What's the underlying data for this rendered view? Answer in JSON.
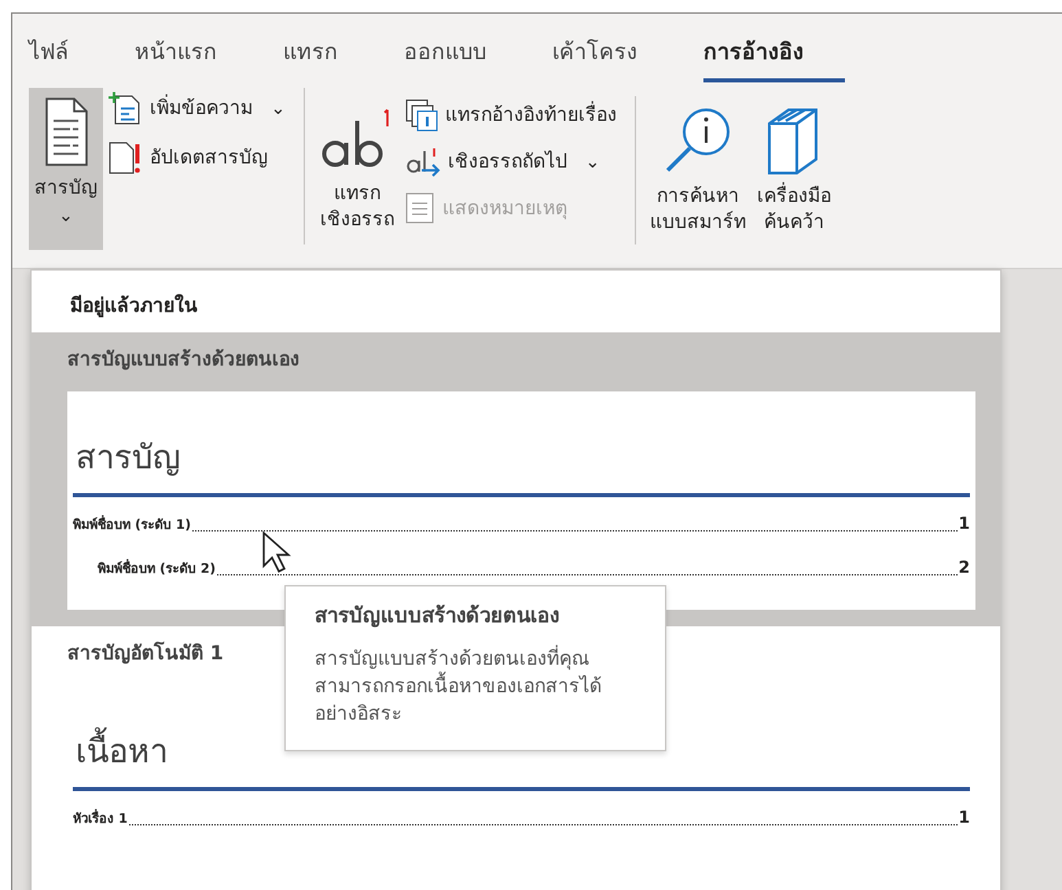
{
  "tabs": [
    {
      "label": "ไฟล์",
      "selected": false
    },
    {
      "label": "หน้าแรก",
      "selected": false
    },
    {
      "label": "แทรก",
      "selected": false
    },
    {
      "label": "ออกแบบ",
      "selected": false
    },
    {
      "label": "เค้าโครง",
      "selected": false
    },
    {
      "label": "การอ้างอิง",
      "selected": true
    }
  ],
  "ribbon_groups": [
    {
      "items": [
        {
          "kind": "large",
          "label": "สารบัญ",
          "caret": true,
          "pressed": true,
          "disabled": false
        },
        {
          "kind": "small",
          "label": "เพิ่มข้อความ",
          "caret": true,
          "pressed": false,
          "disabled": false
        },
        {
          "kind": "small",
          "label": "อัปเดตสารบัญ",
          "caret": false,
          "pressed": false,
          "disabled": false
        }
      ]
    },
    {
      "items": [
        {
          "kind": "large",
          "label": "แทรก\nเชิงอรรถ",
          "caret": false,
          "pressed": false,
          "disabled": false
        },
        {
          "kind": "small",
          "label": "แทรกอ้างอิงท้ายเรื่อง",
          "caret": false,
          "pressed": false,
          "disabled": false
        },
        {
          "kind": "small",
          "label": "เชิงอรรถถัดไป",
          "caret": true,
          "pressed": false,
          "disabled": false
        },
        {
          "kind": "small",
          "label": "แสดงหมายเหตุ",
          "caret": false,
          "pressed": false,
          "disabled": true
        }
      ]
    },
    {
      "items": [
        {
          "kind": "large",
          "label": "การค้นหา\nแบบสมาร์ท",
          "caret": false,
          "pressed": false,
          "disabled": false
        },
        {
          "kind": "large",
          "label": "เครื่องมือ\nค้นคว้า",
          "caret": false,
          "pressed": false,
          "disabled": false
        }
      ]
    }
  ],
  "caret_glyph": "⌄",
  "dropdown": {
    "heading": "มีอยู่แล้วภายใน",
    "gallery": [
      {
        "title": "สารบัญแบบสร้างด้วยตนเอง",
        "selected": true,
        "preview": {
          "heading": "สารบัญ",
          "entries": [
            {
              "text": "พิมพ์ชื่อบท (ระดับ 1)",
              "page": "1",
              "children": [
                {
                  "text": "พิมพ์ชื่อบท (ระดับ 2)",
                  "page": "2"
                }
              ]
            }
          ]
        }
      },
      {
        "title": "สารบัญอัตโนมัติ 1",
        "selected": false,
        "preview": {
          "heading": "เนื้อหา",
          "entries": [
            {
              "text": "หัวเรื่อง 1",
              "page": "1"
            }
          ]
        }
      }
    ]
  },
  "tooltip": {
    "title": "สารบัญแบบสร้างด้วยตนเอง",
    "text": "สารบัญแบบสร้างด้วยตนเองที่คุณสามารถกรอกเนื้อหาของเอกสารได้อย่างอิสระ"
  }
}
